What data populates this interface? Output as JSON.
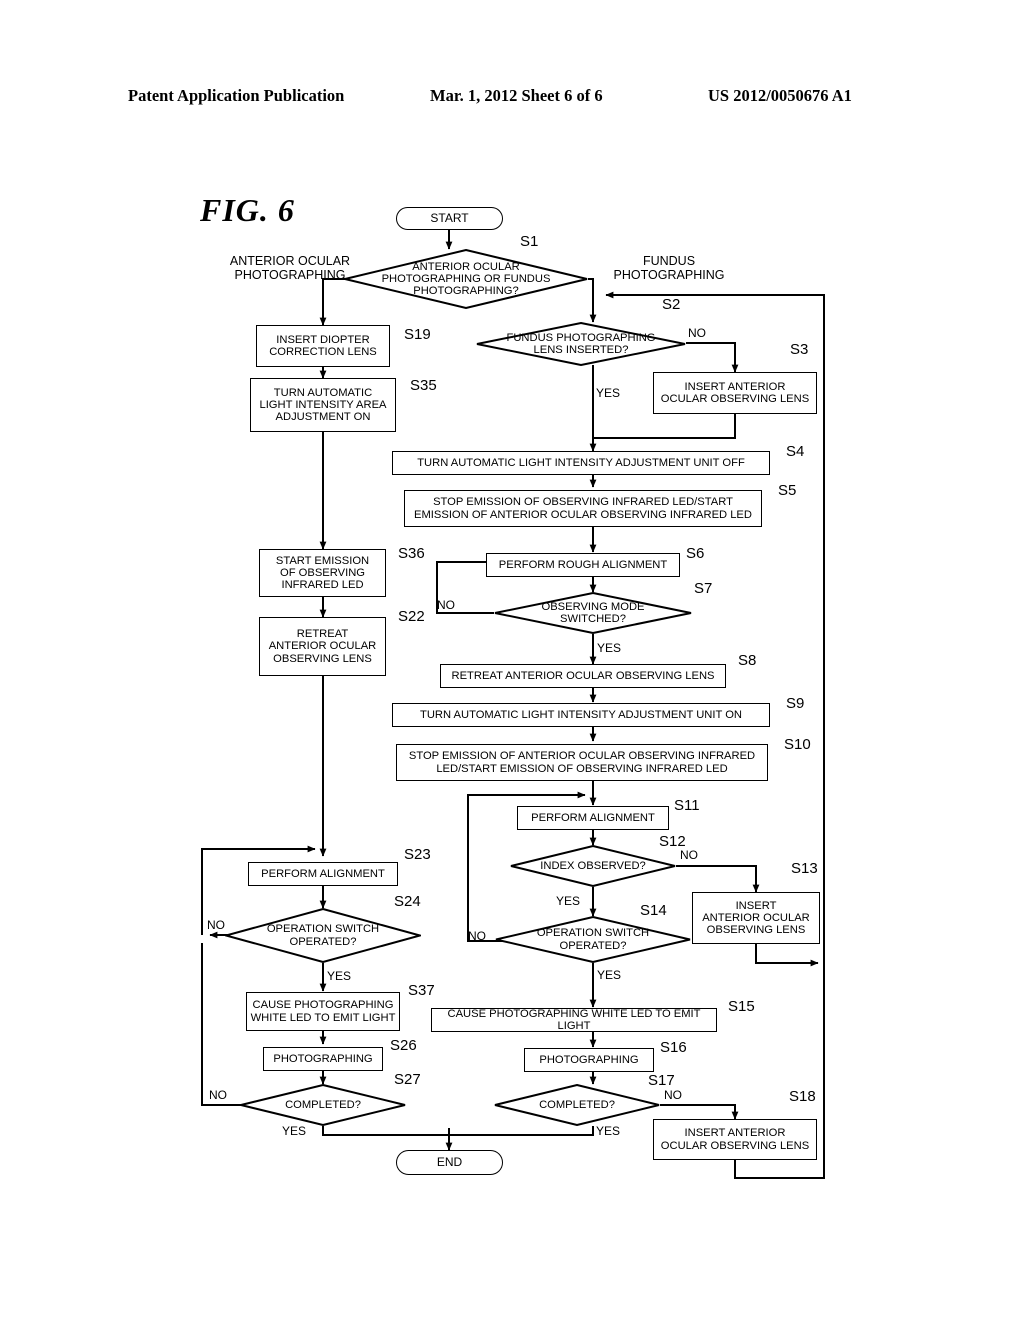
{
  "header": {
    "publication": "Patent Application Publication",
    "date_sheet": "Mar. 1, 2012   Sheet 6 of 6",
    "patent_number": "US 2012/0050676 A1"
  },
  "figure": {
    "label": "FIG.  6"
  },
  "side_labels": {
    "left": "ANTERIOR OCULAR\nPHOTOGRAPHING",
    "right": "FUNDUS\nPHOTOGRAPHING"
  },
  "branch_labels": {
    "s2_no": "NO",
    "s2_yes": "YES",
    "s7_no": "NO",
    "s7_yes": "YES",
    "s12_no": "NO",
    "s12_yes": "YES",
    "s14_no": "NO",
    "s14_yes": "YES",
    "s17_no": "NO",
    "s17_yes": "YES",
    "s24_no": "NO",
    "s24_yes": "YES",
    "s27_no": "NO",
    "s27_yes": "YES"
  },
  "nodes": {
    "start": {
      "tag": "",
      "text": "START"
    },
    "end": {
      "tag": "",
      "text": "END"
    },
    "s1": {
      "tag": "S1",
      "text": "ANTERIOR OCULAR\nPHOTOGRAPHING OR FUNDUS\nPHOTOGRAPHING?"
    },
    "s2": {
      "tag": "S2",
      "text": "FUNDUS PHOTOGRAPHING\nLENS INSERTED?"
    },
    "s3": {
      "tag": "S3",
      "text": "INSERT ANTERIOR\nOCULAR OBSERVING LENS"
    },
    "s4": {
      "tag": "S4",
      "text": "TURN AUTOMATIC LIGHT INTENSITY ADJUSTMENT UNIT OFF"
    },
    "s5": {
      "tag": "S5",
      "text": "STOP EMISSION OF OBSERVING INFRARED LED/START\nEMISSION OF ANTERIOR OCULAR OBSERVING INFRARED LED"
    },
    "s6": {
      "tag": "S6",
      "text": "PERFORM  ROUGH ALIGNMENT"
    },
    "s7": {
      "tag": "S7",
      "text": "OBSERVING MODE\nSWITCHED?"
    },
    "s8": {
      "tag": "S8",
      "text": "RETREAT ANTERIOR OCULAR OBSERVING LENS"
    },
    "s9": {
      "tag": "S9",
      "text": "TURN AUTOMATIC LIGHT INTENSITY ADJUSTMENT UNIT ON"
    },
    "s10": {
      "tag": "S10",
      "text": "STOP EMISSION OF ANTERIOR OCULAR OBSERVING INFRARED\nLED/START EMISSION OF OBSERVING INFRARED LED"
    },
    "s11": {
      "tag": "S11",
      "text": "PERFORM ALIGNMENT"
    },
    "s12": {
      "tag": "S12",
      "text": "INDEX OBSERVED?"
    },
    "s13": {
      "tag": "S13",
      "text": "INSERT\nANTERIOR OCULAR\nOBSERVING LENS"
    },
    "s14": {
      "tag": "S14",
      "text": "OPERATION SWITCH\nOPERATED?"
    },
    "s15": {
      "tag": "S15",
      "text": "CAUSE PHOTOGRAPHING WHITE LED TO EMIT LIGHT"
    },
    "s16": {
      "tag": "S16",
      "text": "PHOTOGRAPHING"
    },
    "s17": {
      "tag": "S17",
      "text": "COMPLETED?"
    },
    "s18": {
      "tag": "S18",
      "text": "INSERT ANTERIOR\nOCULAR OBSERVING LENS"
    },
    "s19": {
      "tag": "S19",
      "text": "INSERT DIOPTER\nCORRECTION LENS"
    },
    "s22": {
      "tag": "S22",
      "text": "RETREAT\nANTERIOR OCULAR\nOBSERVING LENS"
    },
    "s23": {
      "tag": "S23",
      "text": "PERFORM ALIGNMENT"
    },
    "s24": {
      "tag": "S24",
      "text": "OPERATION SWITCH\nOPERATED?"
    },
    "s26": {
      "tag": "S26",
      "text": "PHOTOGRAPHING"
    },
    "s27": {
      "tag": "S27",
      "text": "COMPLETED?"
    },
    "s35": {
      "tag": "S35",
      "text": "TURN AUTOMATIC\nLIGHT INTENSITY AREA\nADJUSTMENT ON"
    },
    "s36": {
      "tag": "S36",
      "text": "START EMISSION\nOF OBSERVING\nINFRARED LED"
    },
    "s37": {
      "tag": "S37",
      "text": "CAUSE PHOTOGRAPHING\nWHITE LED TO EMIT LIGHT"
    }
  },
  "colors": {
    "ink": "#000000",
    "paper": "#ffffff"
  }
}
